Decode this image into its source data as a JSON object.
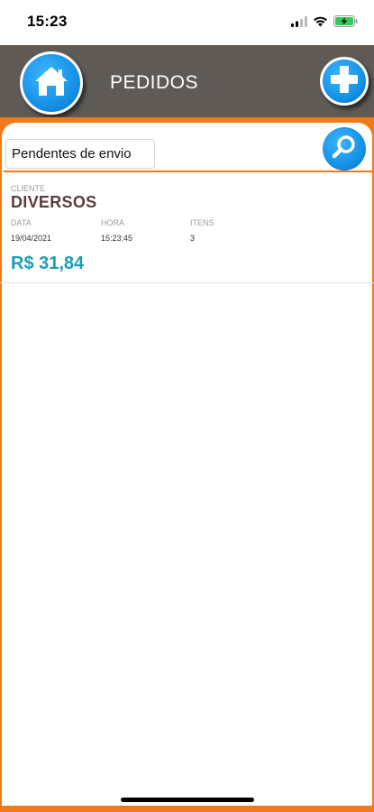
{
  "status_bar": {
    "time": "15:23",
    "icons": [
      "signal-icon",
      "wifi-icon",
      "battery-charging-icon"
    ]
  },
  "header": {
    "title": "PEDIDOS",
    "left_button_icon": "home-icon",
    "right_button_icon": "plus-icon"
  },
  "search": {
    "filter_value": "Pendentes de envio",
    "button_icon": "search-icon"
  },
  "orders": [
    {
      "client_label": "CLIENTE",
      "client_name": "DIVERSOS",
      "date_label": "DATA",
      "date": "19/04/2021",
      "time_label": "HORA",
      "time": "15:23:45",
      "items_label": "ITENS",
      "items": "3",
      "total": "R$ 31,84"
    }
  ],
  "colors": {
    "header_bg": "#5f5a55",
    "accent_orange": "#f07a1a",
    "button_blue": "#1592e6",
    "client_name": "#5a3b3f",
    "total_teal": "#1a9eb5"
  }
}
